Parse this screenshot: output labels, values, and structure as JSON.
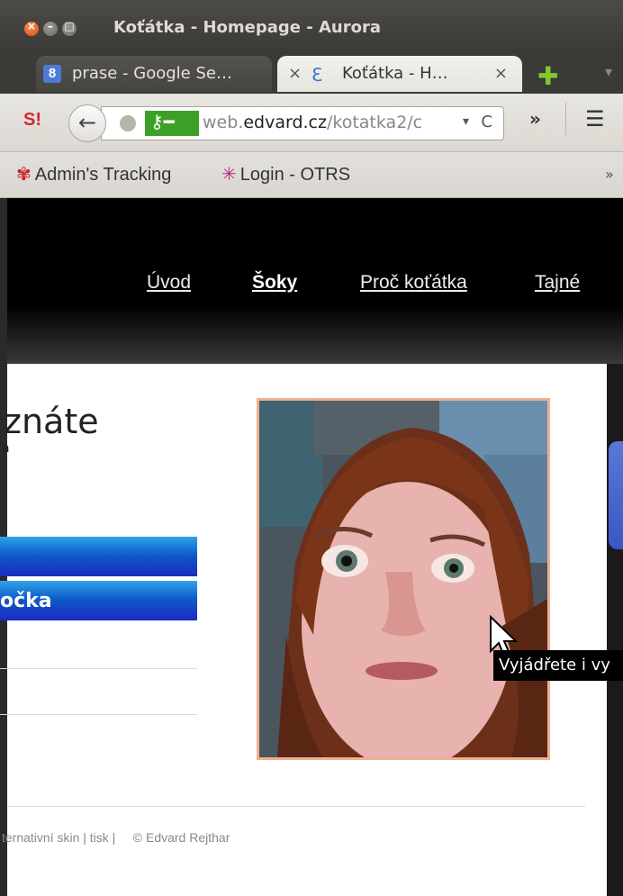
{
  "window": {
    "title": "Koťátka - Homepage - Aurora",
    "buttons": {
      "close": "×",
      "minimize": "–",
      "maximize": "□"
    }
  },
  "tabs": [
    {
      "icon": "google-icon",
      "icon_text": "8",
      "title": "prase - Google Se…",
      "active": false
    },
    {
      "icon": "site-favicon",
      "title": "Koťátka - H…",
      "active": true,
      "close": "×"
    }
  ],
  "tabstrip": {
    "new_tab": "✚",
    "list": "▾",
    "close_left": "×"
  },
  "navbar": {
    "ext_icon_text": "S!",
    "back": "←",
    "url": {
      "prefix": "web.",
      "domain": "edvard.cz",
      "path": "/kotatka2/c"
    },
    "dropdown": "▾",
    "reload": "C",
    "overflow": "»",
    "menu": "☰"
  },
  "bookmarks": {
    "items": [
      {
        "label": "Admin's Tracking",
        "icon": "✾"
      },
      {
        "label": "Login - OTRS",
        "icon": "✳"
      }
    ],
    "more": "»"
  },
  "site_nav": [
    "Úvod",
    "Šoky",
    "Proč koťátka",
    "Tajné"
  ],
  "content": {
    "heading": "znáte",
    "subletter": "a",
    "buttons": [
      "",
      "očka"
    ],
    "footer": {
      "link1": "ternativní skin",
      "sep1": " | ",
      "link2": "tisk",
      "sep2": " |     ",
      "copyright": "© Edvard Rejthar"
    }
  },
  "tooltip": "Vyjádřete i vy",
  "colors": {
    "accent_green": "#3ca028",
    "button_blue": "#0d56c8",
    "photo_border": "#f0b090"
  }
}
